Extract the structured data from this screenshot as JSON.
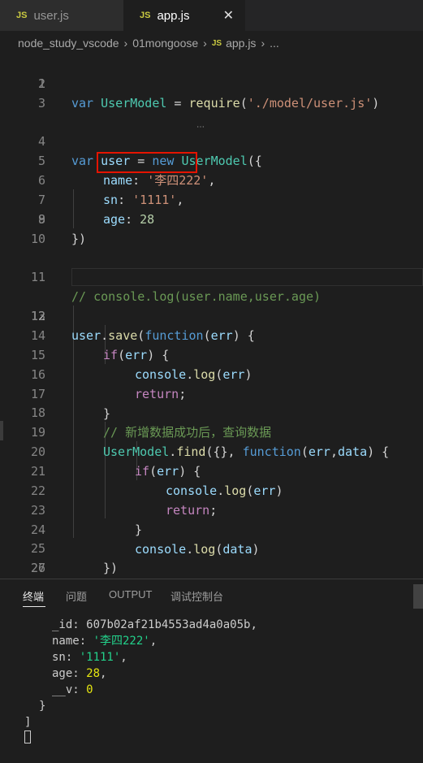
{
  "tabs": [
    {
      "icon": "JS",
      "label": "user.js",
      "active": false
    },
    {
      "icon": "JS",
      "label": "app.js",
      "active": true,
      "close": "✕"
    }
  ],
  "breadcrumb": {
    "folder1": "node_study_vscode",
    "folder2": "01mongoose",
    "file_icon": "JS",
    "file": "app.js",
    "more": "..."
  },
  "editor": {
    "lines": [
      {
        "num": "1"
      },
      {
        "num": "2"
      },
      {
        "num": "3"
      },
      {
        "num": "4"
      },
      {
        "num": "5"
      },
      {
        "num": "6"
      },
      {
        "num": "7"
      },
      {
        "num": "8"
      },
      {
        "num": "9"
      },
      {
        "num": "10"
      },
      {
        "num": "11"
      },
      {
        "num": "12"
      },
      {
        "num": "13"
      },
      {
        "num": "14"
      },
      {
        "num": "15"
      },
      {
        "num": "16"
      },
      {
        "num": "17"
      },
      {
        "num": "18"
      },
      {
        "num": "19"
      },
      {
        "num": "20"
      },
      {
        "num": "21"
      },
      {
        "num": "22"
      },
      {
        "num": "23"
      },
      {
        "num": "24"
      },
      {
        "num": "25"
      },
      {
        "num": "26"
      },
      {
        "num": "27"
      }
    ],
    "code": {
      "l1": [
        "var",
        " ",
        "UserModel",
        " = ",
        "require",
        "(",
        "'./model/user.js'",
        ")"
      ],
      "l4": [
        "var",
        " ",
        "user",
        " = ",
        "new",
        " ",
        "UserModel",
        "({"
      ],
      "l5": [
        "name",
        ": ",
        "'李四222'",
        ","
      ],
      "l6": [
        "sn",
        ": ",
        "'1111'",
        ","
      ],
      "l7": [
        "age",
        ": ",
        "28"
      ],
      "l8": [
        "})"
      ],
      "l11": [
        "// console.log(user.name,user.age)"
      ],
      "l13": [
        "user",
        ".",
        "save",
        "(",
        "function",
        "(",
        "err",
        ") {"
      ],
      "l14": [
        "if",
        "(",
        "err",
        ") {"
      ],
      "l15": [
        "console",
        ".",
        "log",
        "(",
        "err",
        ")"
      ],
      "l16": [
        "return",
        ";"
      ],
      "l17": [
        "}"
      ],
      "l18": [
        "// 新增数据成功后，查询数据"
      ],
      "l19": [
        "UserModel",
        ".",
        "find",
        "({}, ",
        "function",
        "(",
        "err",
        ",",
        "data",
        ") {"
      ],
      "l20": [
        "if",
        "(",
        "err",
        ") {"
      ],
      "l21": [
        "console",
        ".",
        "log",
        "(",
        "err",
        ")"
      ],
      "l22": [
        "return",
        ";"
      ],
      "l23": [
        "}"
      ],
      "l24": [
        "console",
        ".",
        "log",
        "(",
        "data",
        ")"
      ],
      "l25": [
        "})"
      ],
      "l26": [
        "})"
      ]
    }
  },
  "panel": {
    "tabs": [
      "终端",
      "问题",
      "OUTPUT",
      "调试控制台"
    ],
    "terminal": {
      "l1": [
        "_id: ",
        "607b02af21b4553ad4a0a05b,"
      ],
      "l2": [
        "name: ",
        "'李四222'",
        ","
      ],
      "l3": [
        "sn: ",
        "'1111'",
        ","
      ],
      "l4": [
        "age: ",
        "28",
        ","
      ],
      "l5": [
        "__v: ",
        "0"
      ],
      "l6": [
        "}"
      ],
      "l7": [
        "]"
      ]
    }
  },
  "colors": {
    "keyword": "#569cd6",
    "variable": "#9cdcfe",
    "class": "#4ec9b0",
    "string": "#ce9178",
    "number": "#b5cea8",
    "function": "#dcdcaa",
    "control": "#c586c0",
    "comment": "#6a9955",
    "highlight_box": "#e51400"
  }
}
